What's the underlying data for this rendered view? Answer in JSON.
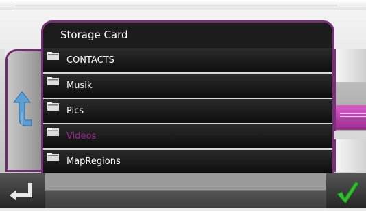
{
  "window": {
    "title": "Storage Card"
  },
  "folders": [
    {
      "label": "CONTACTS",
      "selected": false
    },
    {
      "label": "Musik",
      "selected": false
    },
    {
      "label": "Pics",
      "selected": false
    },
    {
      "label": "Videos",
      "selected": true
    },
    {
      "label": "MapRegions",
      "selected": false
    }
  ],
  "icons": {
    "folder": "folder-icon",
    "back": "back-arrow-icon",
    "up": "up-triangle-icon",
    "down": "down-triangle-icon",
    "enter": "enter-icon",
    "ok": "checkmark-icon"
  },
  "colors": {
    "accent": "#7a2f7a",
    "selected_text": "#a02b95",
    "list_bg": "#1c1c1c",
    "ok": "#2fbf2f"
  }
}
